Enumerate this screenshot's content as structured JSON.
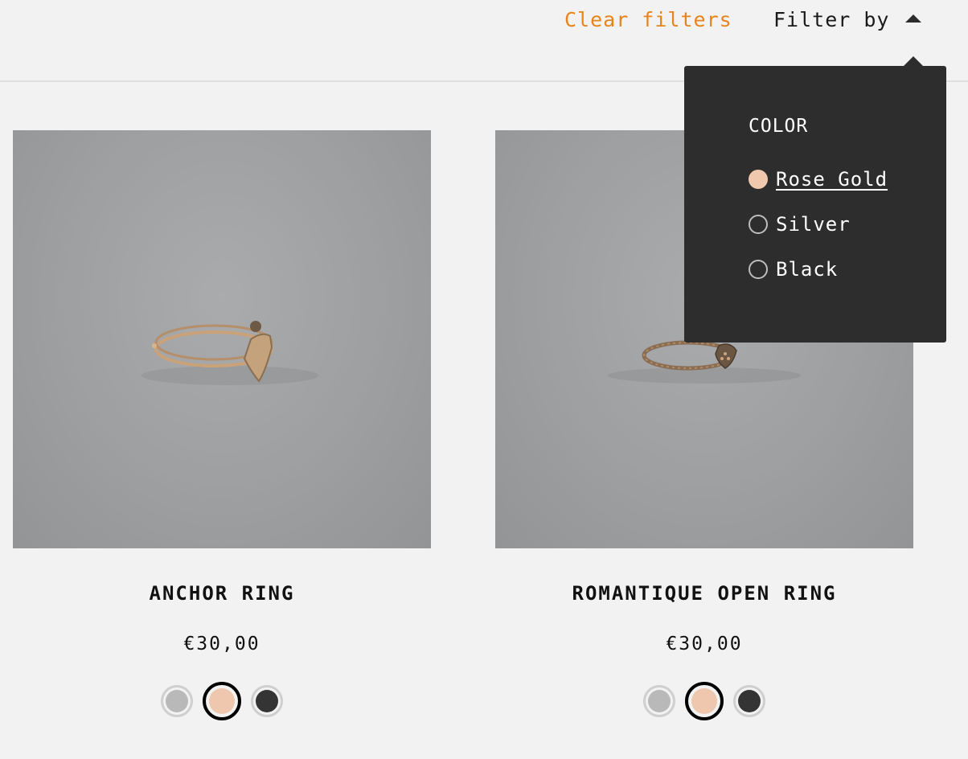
{
  "header": {
    "clear_filters": "Clear filters",
    "filter_by": "Filter by",
    "filter_caret_icon": "caret-up-icon"
  },
  "filter_panel": {
    "heading": "COLOR",
    "options": [
      {
        "label": "Rose Gold",
        "color": "#f0c8ad",
        "selected": true
      },
      {
        "label": "Silver",
        "color": "",
        "selected": false
      },
      {
        "label": "Black",
        "color": "",
        "selected": false
      }
    ]
  },
  "products": [
    {
      "name": "ANCHOR RING",
      "price": "€30,00",
      "swatches": [
        {
          "color": "#b9b9b9",
          "selected": false
        },
        {
          "color": "#efc7ae",
          "selected": true
        },
        {
          "color": "#343434",
          "selected": false
        }
      ]
    },
    {
      "name": "ROMANTIQUE OPEN RING",
      "price": "€30,00",
      "swatches": [
        {
          "color": "#b9b9b9",
          "selected": false
        },
        {
          "color": "#efc7ae",
          "selected": true
        },
        {
          "color": "#343434",
          "selected": false
        }
      ]
    }
  ],
  "colors": {
    "accent": "#e8841c",
    "panel_background": "#2d2d2d",
    "page_background": "#f2f2f2"
  }
}
